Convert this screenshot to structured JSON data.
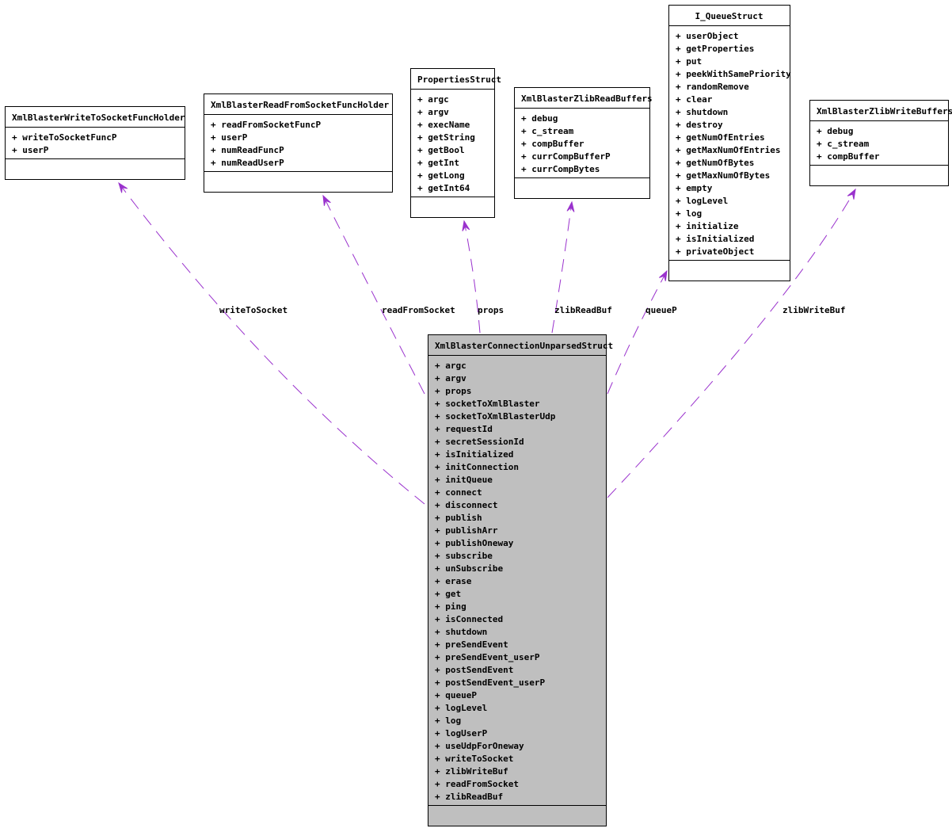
{
  "colors": {
    "edge": "#9a32cd",
    "main_fill": "#bfbfbf",
    "box_fill": "#ffffff",
    "border": "#000000"
  },
  "main_class": {
    "name": "XmlBlasterConnectionUnparsedStruct",
    "members": [
      "argc",
      "argv",
      "props",
      "socketToXmlBlaster",
      "socketToXmlBlasterUdp",
      "requestId",
      "secretSessionId",
      "isInitialized",
      "initConnection",
      "initQueue",
      "connect",
      "disconnect",
      "publish",
      "publishArr",
      "publishOneway",
      "subscribe",
      "unSubscribe",
      "erase",
      "get",
      "ping",
      "isConnected",
      "shutdown",
      "preSendEvent",
      "preSendEvent_userP",
      "postSendEvent",
      "postSendEvent_userP",
      "queueP",
      "logLevel",
      "log",
      "logUserP",
      "useUdpForOneway",
      "writeToSocket",
      "zlibWriteBuf",
      "readFromSocket",
      "zlibReadBuf"
    ]
  },
  "classes": [
    {
      "id": "write",
      "name": "XmlBlasterWriteToSocketFuncHolder",
      "members": [
        "writeToSocketFuncP",
        "userP"
      ]
    },
    {
      "id": "read",
      "name": "XmlBlasterReadFromSocketFuncHolder",
      "members": [
        "readFromSocketFuncP",
        "userP",
        "numReadFuncP",
        "numReadUserP"
      ]
    },
    {
      "id": "props",
      "name": "PropertiesStruct",
      "members": [
        "argc",
        "argv",
        "execName",
        "getString",
        "getBool",
        "getInt",
        "getLong",
        "getInt64"
      ]
    },
    {
      "id": "zread",
      "name": "XmlBlasterZlibReadBuffers",
      "members": [
        "debug",
        "c_stream",
        "compBuffer",
        "currCompBufferP",
        "currCompBytes"
      ]
    },
    {
      "id": "queue",
      "name": "I_QueueStruct",
      "members": [
        "userObject",
        "getProperties",
        "put",
        "peekWithSamePriority",
        "randomRemove",
        "clear",
        "shutdown",
        "destroy",
        "getNumOfEntries",
        "getMaxNumOfEntries",
        "getNumOfBytes",
        "getMaxNumOfBytes",
        "empty",
        "logLevel",
        "log",
        "initialize",
        "isInitialized",
        "privateObject"
      ]
    },
    {
      "id": "zwrite",
      "name": "XmlBlasterZlibWriteBuffers",
      "members": [
        "debug",
        "c_stream",
        "compBuffer"
      ]
    }
  ],
  "edges": [
    {
      "target": "write",
      "label": "writeToSocket"
    },
    {
      "target": "read",
      "label": "readFromSocket"
    },
    {
      "target": "props",
      "label": "props"
    },
    {
      "target": "zread",
      "label": "zlibReadBuf"
    },
    {
      "target": "queue",
      "label": "queueP"
    },
    {
      "target": "zwrite",
      "label": "zlibWriteBuf"
    }
  ],
  "member_prefix": "+"
}
